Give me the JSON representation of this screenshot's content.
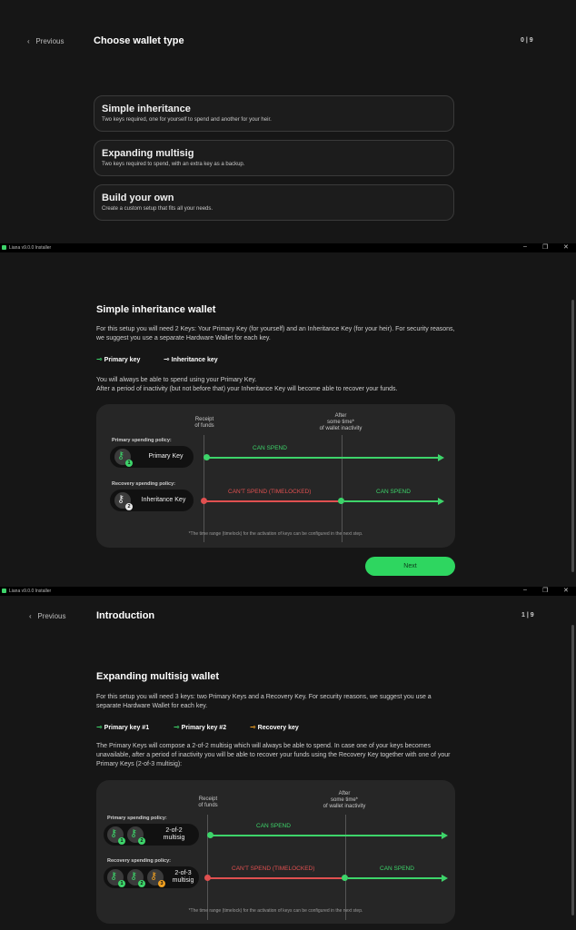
{
  "screen1": {
    "prev": "Previous",
    "title": "Choose wallet type",
    "step": "0 | 9",
    "options": [
      {
        "title": "Simple inheritance",
        "desc": "Two keys required, one for yourself to spend and another for your heir."
      },
      {
        "title": "Expanding multisig",
        "desc": "Two keys required to spend, with an extra key as a backup."
      },
      {
        "title": "Build your own",
        "desc": "Create a custom setup that fits all your needs."
      }
    ]
  },
  "window": {
    "title": "Liana v9.0.0 Installer",
    "controls": [
      "–",
      "❐",
      "✕"
    ]
  },
  "screen2": {
    "heading": "Simple inheritance wallet",
    "para1": "For this setup you will need 2 Keys: Your Primary Key (for yourself) and an Inheritance Key (for your heir). For security reasons, we suggest you use a separate Hardware Wallet for each key.",
    "legend": [
      "Primary key",
      "Inheritance key"
    ],
    "para2a": "You will always be able to spend using your Primary Key.",
    "para2b": "After a period of inactivity (but not before that) your Inheritance Key will become able to recover your funds.",
    "receipt": "Receipt\nof funds",
    "after": "After\nsome time*\nof wallet inactivity",
    "primary_policy": "Primary spending policy:",
    "recovery_policy": "Recovery spending policy:",
    "primary_key": "Primary Key",
    "inheritance_key": "Inheritance Key",
    "can_spend": "CAN SPEND",
    "cant_spend": "CAN'T SPEND (TIMELOCKED)",
    "footnote": "*The time range (timelock) for the activation of keys can be configured in the next step.",
    "next": "Next"
  },
  "screen3": {
    "prev": "Previous",
    "title": "Introduction",
    "step": "1 | 9",
    "heading": "Expanding multisig wallet",
    "para1": "For this setup you will need 3 keys: two Primary Keys and a Recovery Key. For security reasons, we suggest you use a separate Hardware Wallet for each key.",
    "legend": [
      "Primary key #1",
      "Primary key #2",
      "Recovery key"
    ],
    "para2": "The Primary Keys will compose a 2-of-2 multisig which will always be able to spend. In case one of your keys becomes unavailable, after a period of inactivity you will be able to recover your funds using the Recovery Key together with one of your Primary Keys (2-of-3 multisig):",
    "receipt": "Receipt\nof funds",
    "after": "After\nsome time*\nof wallet inactivity",
    "primary_policy": "Primary spending policy:",
    "recovery_policy": "Recovery spending policy:",
    "multisig_2of2": "2-of-2\nmultisig",
    "multisig_2of3": "2-of-3\nmultisig",
    "can_spend": "CAN SPEND",
    "cant_spend": "CAN'T SPEND (TIMELOCKED)",
    "footnote": "*The time range (timelock) for the activation of keys can be configured in the next step."
  },
  "colors": {
    "accent": "#2ed660",
    "locked": "#e05050",
    "recovery": "#f0a020"
  }
}
